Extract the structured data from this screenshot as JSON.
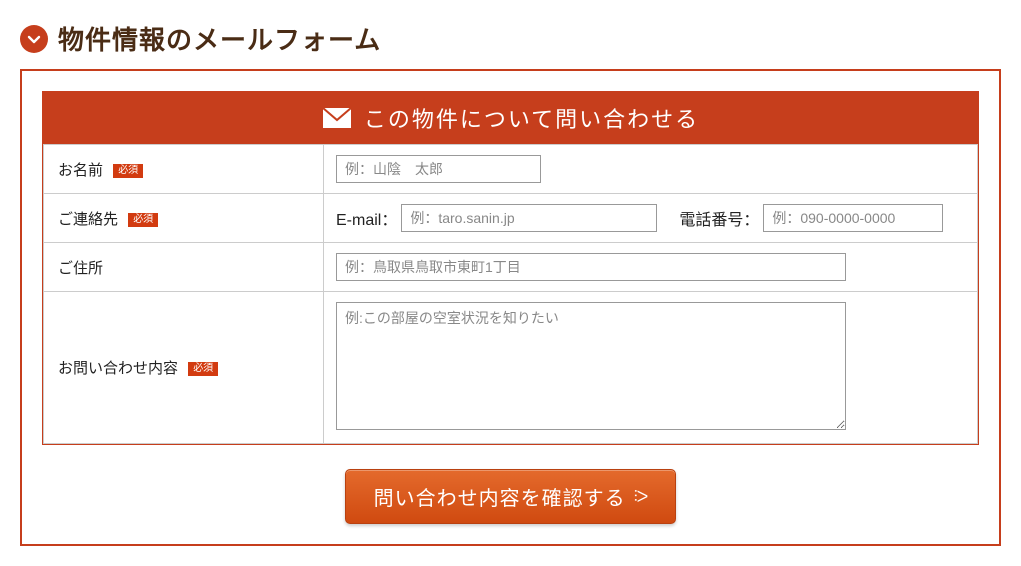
{
  "title": "物件情報のメールフォーム",
  "form_header": "この物件について問い合わせる",
  "labels": {
    "name": "お名前",
    "contact": "ご連絡先",
    "email": "E-mail：",
    "tel": "電話番号：",
    "address": "ご住所",
    "body": "お問い合わせ内容",
    "required": "必須"
  },
  "placeholders": {
    "name": "例：山陰　太郎",
    "email": "例：taro.sanin.jp",
    "tel": "例：090-0000-0000",
    "address": "例：鳥取県鳥取市東町1丁目",
    "body": "例:この部屋の空室状況を知りたい"
  },
  "values": {
    "name": "",
    "email": "",
    "tel": "",
    "address": "",
    "body": ""
  },
  "buttons": {
    "submit": "問い合わせ内容を確認する",
    "submit_arrow": "⫶ᐳ"
  }
}
